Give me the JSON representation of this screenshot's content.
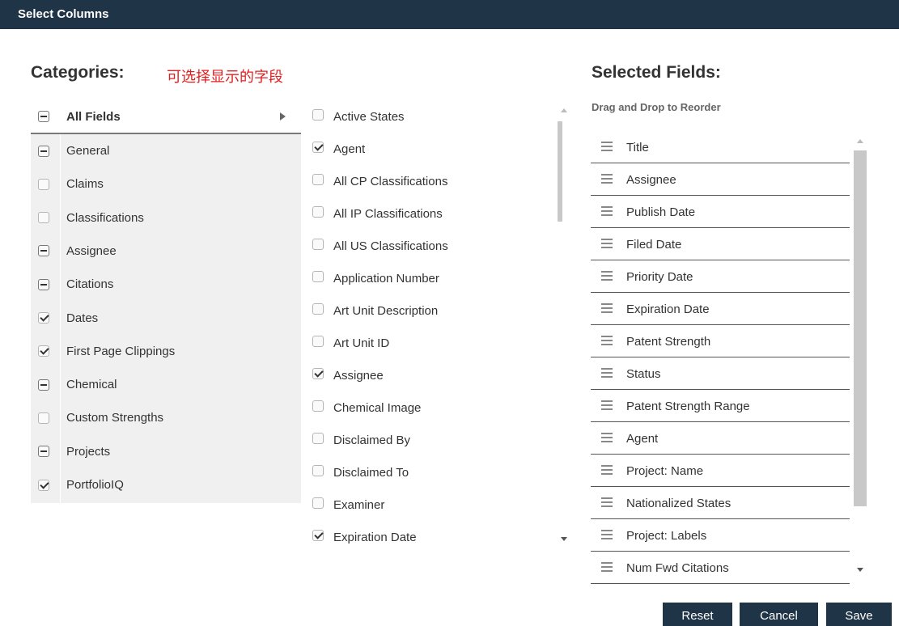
{
  "window": {
    "title": "Select Columns"
  },
  "categories": {
    "heading": "Categories:",
    "note": "可选择显示的字段",
    "items": [
      {
        "label": "All Fields",
        "state": "partial"
      },
      {
        "label": "General",
        "state": "partial"
      },
      {
        "label": "Claims",
        "state": "unchecked"
      },
      {
        "label": "Classifications",
        "state": "unchecked"
      },
      {
        "label": "Assignee",
        "state": "partial"
      },
      {
        "label": "Citations",
        "state": "partial"
      },
      {
        "label": "Dates",
        "state": "checked"
      },
      {
        "label": "First Page Clippings",
        "state": "checked"
      },
      {
        "label": "Chemical",
        "state": "partial"
      },
      {
        "label": "Custom Strengths",
        "state": "unchecked"
      },
      {
        "label": "Projects",
        "state": "partial"
      },
      {
        "label": "PortfolioIQ",
        "state": "checked"
      }
    ]
  },
  "fields": {
    "items": [
      {
        "label": "Active States",
        "checked": false
      },
      {
        "label": "Agent",
        "checked": true
      },
      {
        "label": "All CP Classifications",
        "checked": false
      },
      {
        "label": "All IP Classifications",
        "checked": false
      },
      {
        "label": "All US Classifications",
        "checked": false
      },
      {
        "label": "Application Number",
        "checked": false
      },
      {
        "label": "Art Unit Description",
        "checked": false
      },
      {
        "label": "Art Unit ID",
        "checked": false
      },
      {
        "label": "Assignee",
        "checked": true
      },
      {
        "label": "Chemical Image",
        "checked": false
      },
      {
        "label": "Disclaimed By",
        "checked": false
      },
      {
        "label": "Disclaimed To",
        "checked": false
      },
      {
        "label": "Examiner",
        "checked": false
      },
      {
        "label": "Expiration Date",
        "checked": true
      }
    ]
  },
  "selected": {
    "heading": "Selected Fields:",
    "subheading": "Drag and Drop to Reorder",
    "items": [
      "Title",
      "Assignee",
      "Publish Date",
      "Filed Date",
      "Priority Date",
      "Expiration Date",
      "Patent Strength",
      "Status",
      "Patent Strength Range",
      "Agent",
      "Project: Name",
      "Nationalized States",
      "Project: Labels",
      "Num Fwd Citations"
    ]
  },
  "buttons": {
    "reset": "Reset",
    "cancel": "Cancel",
    "save": "Save"
  }
}
